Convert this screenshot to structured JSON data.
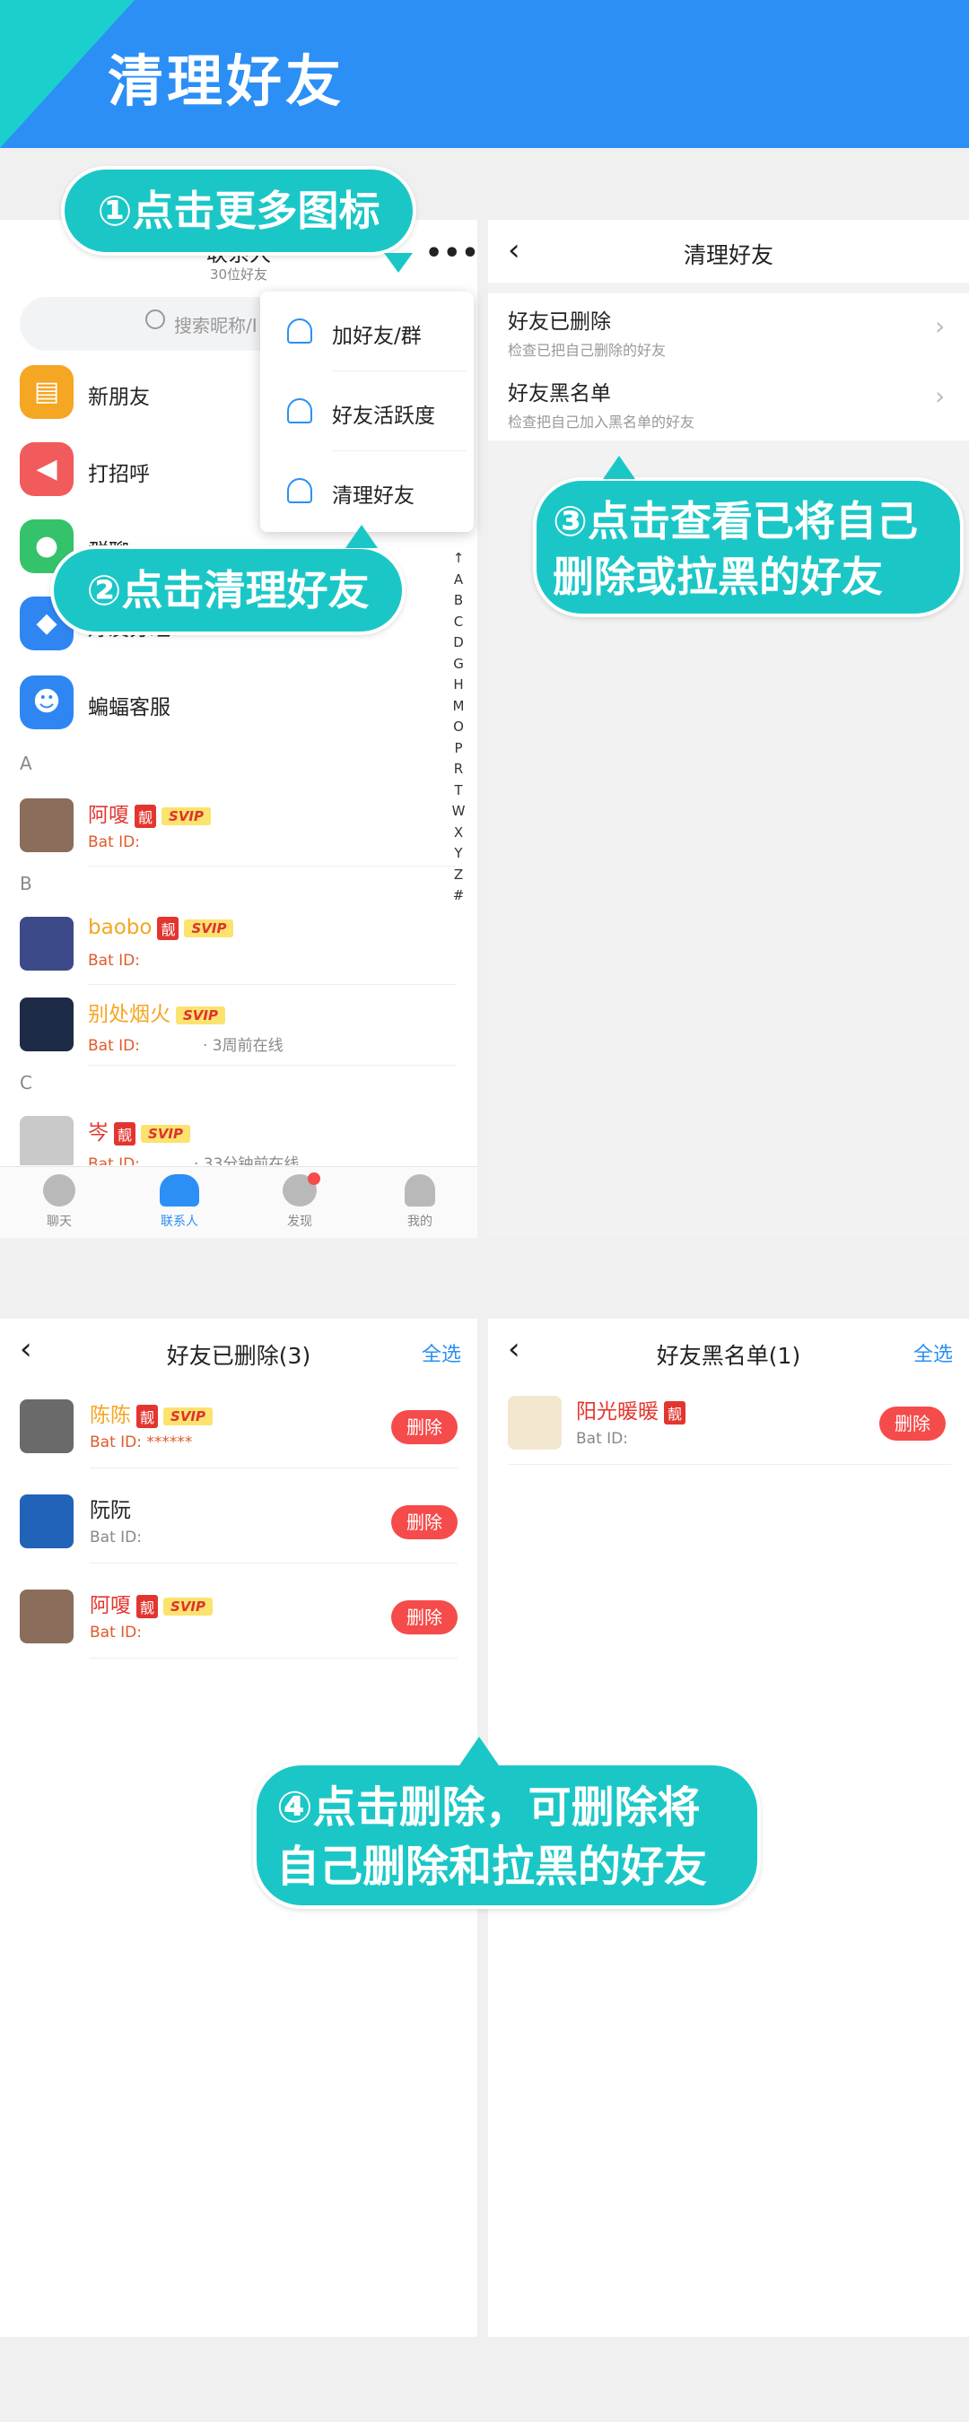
{
  "header": {
    "title": "清理好友"
  },
  "callouts": {
    "step1": "①点击更多图标",
    "step2": "②点击清理好友",
    "step3_line1": "③点击查看已将自己",
    "step3_line2": "删除或拉黑的好友",
    "step4_line1": "④点击删除，可删除将",
    "step4_line2": "自己删除和拉黑的好友"
  },
  "contacts": {
    "title": "联系人",
    "subtitle": "30位好友",
    "search_placeholder": "搜索昵称/I",
    "menu": [
      "加好友/群",
      "好友活跃度",
      "清理好友"
    ],
    "entries": [
      {
        "label": "新朋友",
        "color": "#f5a623"
      },
      {
        "label": "打招呼",
        "color": "#f25b5b"
      },
      {
        "label": "群聊",
        "color": "#34c36a"
      },
      {
        "label": "好友分组",
        "color": "#2f86f2"
      },
      {
        "label": "蝙蝠客服",
        "color": "#2f86f2"
      }
    ],
    "sections": [
      "A",
      "B",
      "C"
    ],
    "friends": [
      {
        "name": "阿嗄",
        "tag": "靓",
        "svip": "SVIP",
        "bat": "Bat ID:",
        "status": ""
      },
      {
        "name": "baobo",
        "tag": "靓",
        "svip": "SVIP",
        "bat": "Bat ID:",
        "status": ""
      },
      {
        "name": "别处烟火",
        "tag": "",
        "svip": "SVIP",
        "bat": "Bat ID:",
        "status": "· 3周前在线"
      },
      {
        "name": "岑",
        "tag": "靓",
        "svip": "SVIP",
        "bat": "Bat ID:",
        "status": "· 33分钟前在线"
      }
    ],
    "index": [
      "↑",
      "A",
      "B",
      "C",
      "D",
      "G",
      "H",
      "M",
      "O",
      "P",
      "R",
      "T",
      "W",
      "X",
      "Y",
      "Z",
      "#"
    ],
    "tabs": [
      "聊天",
      "联系人",
      "发现",
      "我的"
    ]
  },
  "clean": {
    "title": "清理好友",
    "rows": [
      {
        "title": "好友已删除",
        "sub": "检查已把自己删除的好友"
      },
      {
        "title": "好友黑名单",
        "sub": "检查把自己加入黑名单的好友"
      }
    ]
  },
  "deleted": {
    "title": "好友已删除(3)",
    "select_all": "全选",
    "delete_label": "删除",
    "items": [
      {
        "name": "陈陈",
        "tag": "靓",
        "svip": "SVIP",
        "bat": "Bat ID: ******"
      },
      {
        "name": "阮阮",
        "tag": "",
        "svip": "",
        "bat": "Bat ID:"
      },
      {
        "name": "阿嗄",
        "tag": "靓",
        "svip": "SVIP",
        "bat": "Bat ID:"
      }
    ]
  },
  "blacklist": {
    "title": "好友黑名单(1)",
    "select_all": "全选",
    "delete_label": "删除",
    "items": [
      {
        "name": "阳光暖暖",
        "tag": "靓",
        "bat": "Bat ID:"
      }
    ]
  },
  "colors": {
    "brand": "#2b8ff5",
    "accent": "#1bc7c6",
    "danger": "#f54b4b",
    "vip": "#f5a623"
  }
}
